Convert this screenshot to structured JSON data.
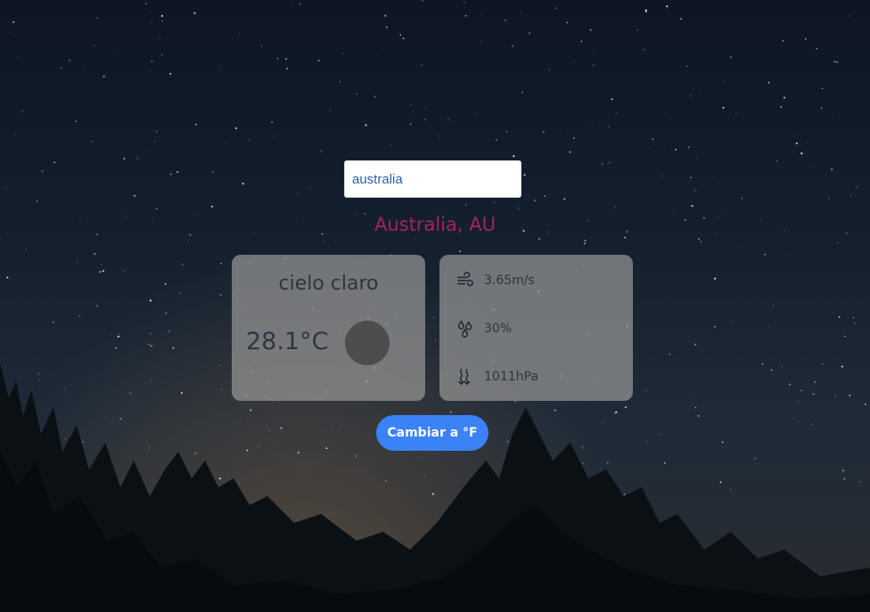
{
  "search": {
    "value": "australia"
  },
  "location": {
    "name": "Australia, AU"
  },
  "current": {
    "description": "cielo claro",
    "temperature": "28.1°C"
  },
  "details": {
    "wind": "3.65m/s",
    "humidity": "30%",
    "pressure": "1011hPa"
  },
  "toggle": {
    "label": "Cambiar a °F"
  },
  "icons": {
    "wind": "wind-icon",
    "humidity": "humidity-drops-icon",
    "pressure": "pressure-waves-icon",
    "weather": "weather-circle-icon"
  },
  "colors": {
    "location": "#a3245a",
    "button": "#3b82f6",
    "card": "#969696"
  }
}
